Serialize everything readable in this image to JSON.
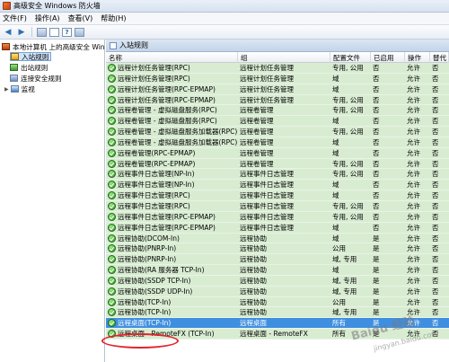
{
  "window": {
    "title": "高级安全 Windows 防火墙"
  },
  "menu": [
    "文件(F)",
    "操作(A)",
    "查看(V)",
    "帮助(H)"
  ],
  "tree": {
    "root": "本地计算机 上的高级安全 Win",
    "items": [
      "入站规则",
      "出站规则",
      "连接安全规则",
      "监视"
    ]
  },
  "pane": {
    "title": "入站规则"
  },
  "columns": [
    "名称",
    "组",
    "配置文件",
    "已启用",
    "操作",
    "替代"
  ],
  "rows": [
    [
      "远程计划任务管理(RPC)",
      "远程计划任务管理",
      "专用, 公用",
      "否",
      "允许",
      "否"
    ],
    [
      "远程计划任务管理(RPC)",
      "远程计划任务管理",
      "域",
      "否",
      "允许",
      "否"
    ],
    [
      "远程计划任务管理(RPC-EPMAP)",
      "远程计划任务管理",
      "域",
      "否",
      "允许",
      "否"
    ],
    [
      "远程计划任务管理(RPC-EPMAP)",
      "远程计划任务管理",
      "专用, 公用",
      "否",
      "允许",
      "否"
    ],
    [
      "远程卷管理 - 虚拟磁盘服务(RPC)",
      "远程卷管理",
      "专用, 公用",
      "否",
      "允许",
      "否"
    ],
    [
      "远程卷管理 - 虚拟磁盘服务(RPC)",
      "远程卷管理",
      "域",
      "否",
      "允许",
      "否"
    ],
    [
      "远程卷管理 - 虚拟磁盘服务加载器(RPC)",
      "远程卷管理",
      "专用, 公用",
      "否",
      "允许",
      "否"
    ],
    [
      "远程卷管理 - 虚拟磁盘服务加载器(RPC)",
      "远程卷管理",
      "域",
      "否",
      "允许",
      "否"
    ],
    [
      "远程卷管理(RPC-EPMAP)",
      "远程卷管理",
      "域",
      "否",
      "允许",
      "否"
    ],
    [
      "远程卷管理(RPC-EPMAP)",
      "远程卷管理",
      "专用, 公用",
      "否",
      "允许",
      "否"
    ],
    [
      "远程事件日志管理(NP-In)",
      "远程事件日志管理",
      "专用, 公用",
      "否",
      "允许",
      "否"
    ],
    [
      "远程事件日志管理(NP-In)",
      "远程事件日志管理",
      "域",
      "否",
      "允许",
      "否"
    ],
    [
      "远程事件日志管理(RPC)",
      "远程事件日志管理",
      "域",
      "否",
      "允许",
      "否"
    ],
    [
      "远程事件日志管理(RPC)",
      "远程事件日志管理",
      "专用, 公用",
      "否",
      "允许",
      "否"
    ],
    [
      "远程事件日志管理(RPC-EPMAP)",
      "远程事件日志管理",
      "专用, 公用",
      "否",
      "允许",
      "否"
    ],
    [
      "远程事件日志管理(RPC-EPMAP)",
      "远程事件日志管理",
      "域",
      "否",
      "允许",
      "否"
    ],
    [
      "远程协助(DCOM-In)",
      "远程协助",
      "域",
      "是",
      "允许",
      "否"
    ],
    [
      "远程协助(PNRP-In)",
      "远程协助",
      "公用",
      "是",
      "允许",
      "否"
    ],
    [
      "远程协助(PNRP-In)",
      "远程协助",
      "域, 专用",
      "是",
      "允许",
      "否"
    ],
    [
      "远程协助(RA 服务器 TCP-In)",
      "远程协助",
      "域",
      "是",
      "允许",
      "否"
    ],
    [
      "远程协助(SSDP TCP-In)",
      "远程协助",
      "域, 专用",
      "是",
      "允许",
      "否"
    ],
    [
      "远程协助(SSDP UDP-In)",
      "远程协助",
      "域, 专用",
      "是",
      "允许",
      "否"
    ],
    [
      "远程协助(TCP-In)",
      "远程协助",
      "公用",
      "是",
      "允许",
      "否"
    ],
    [
      "远程协助(TCP-In)",
      "远程协助",
      "域, 专用",
      "是",
      "允许",
      "否"
    ],
    [
      "远程桌面(TCP-In)",
      "远程桌面",
      "所有",
      "是",
      "允许",
      "否"
    ],
    [
      "远程桌面 - RemoteFX (TCP-In)",
      "远程桌面 - RemoteFX",
      "所有",
      "是",
      "允许",
      "否"
    ]
  ],
  "selected_row": 24,
  "colors": {
    "enabled_row": "#d8ecd2",
    "selected_row": "#3f8fe0",
    "highlight_circle": "#e0262d"
  },
  "watermark": {
    "line1": "Baidu 经验",
    "line2": "jingyan.baidu.com"
  }
}
